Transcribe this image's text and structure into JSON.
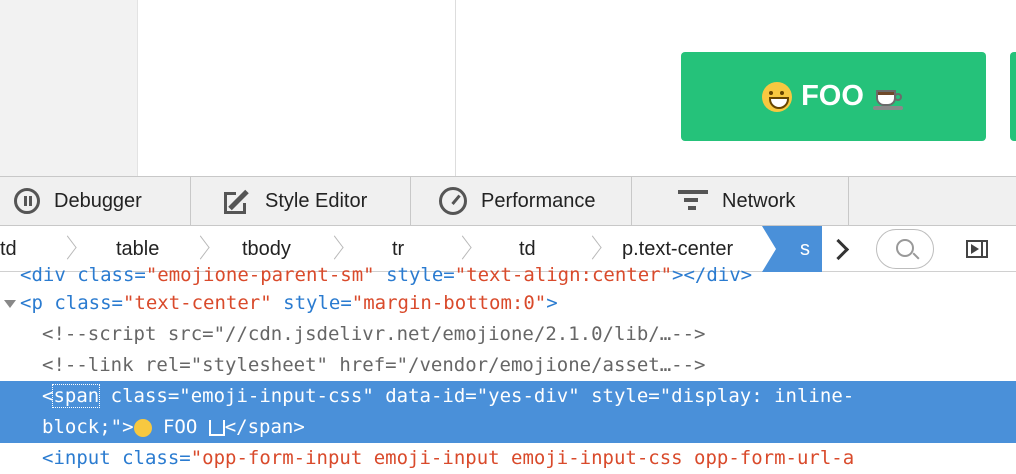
{
  "page": {
    "button_label": "FOO"
  },
  "devtools": {
    "tabs": [
      {
        "label": "Debugger",
        "icon": "debugger-icon"
      },
      {
        "label": "Style Editor",
        "icon": "style-editor-icon"
      },
      {
        "label": "Performance",
        "icon": "performance-icon"
      },
      {
        "label": "Network",
        "icon": "network-icon"
      }
    ],
    "breadcrumbs": [
      "td",
      "table",
      "tbody",
      "tr",
      "td",
      "p.text-center",
      "s"
    ],
    "markup": {
      "line0_tag": "<div ",
      "line0_attr": "class=",
      "line0_val": "\"emojione-parent-sm\"",
      "line0_attr2": " style=",
      "line0_val2": "\"text-align:center\"",
      "line0_end": "></div>",
      "line1_open": "<p ",
      "line1_attr1": "class=",
      "line1_val1": "\"text-center\"",
      "line1_attr2": " style=",
      "line1_val2": "\"margin-bottom:0\"",
      "line1_close": ">",
      "line2": "<!--script src=\"//cdn.jsdelivr.net/emojione/2.1.0/lib/…-->",
      "line3": "<!--link rel=\"stylesheet\" href=\"/vendor/emojione/asset…-->",
      "line4_lt": "<",
      "line4_tag": "span",
      "line4_rest": " class=\"emoji-input-css\" data-id=\"yes-div\" style=\"display: inline-",
      "line5_a": "block;\">",
      "line5_b": " FOO ",
      "line5_c": "</span>",
      "line6_open": "<input ",
      "line6_attr": "class=",
      "line6_val": "\"opp-form-input emoji-input emoji-input-css opp-form-url-a"
    }
  },
  "colors": {
    "button_green": "#25c27a",
    "selection_blue": "#4a90d9",
    "tag_blue": "#2a7bd0",
    "value_red": "#d94a2b"
  }
}
